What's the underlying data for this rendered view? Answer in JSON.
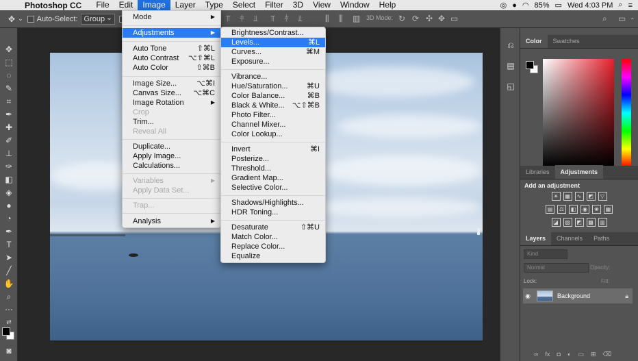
{
  "menubar": {
    "app_name": "Photoshop CC",
    "menus": [
      "File",
      "Edit",
      "Image",
      "Layer",
      "Type",
      "Select",
      "Filter",
      "3D",
      "View",
      "Window",
      "Help"
    ],
    "active_menu": "Image",
    "battery": "85%",
    "clock": "Wed 4:03 PM"
  },
  "options_bar": {
    "auto_select_label": "Auto-Select:",
    "auto_select_value": "Group",
    "show_label": "Sh",
    "mode_label": "3D Mode:"
  },
  "image_menu": {
    "items": [
      {
        "label": "Mode",
        "submenu": true
      },
      {
        "label": "Adjustments",
        "submenu": true,
        "highlighted": true
      },
      {
        "label": "Auto Tone",
        "shortcut": "⇧⌘L"
      },
      {
        "label": "Auto Contrast",
        "shortcut": "⌥⇧⌘L"
      },
      {
        "label": "Auto Color",
        "shortcut": "⇧⌘B"
      },
      {
        "label": "Image Size...",
        "shortcut": "⌥⌘I"
      },
      {
        "label": "Canvas Size...",
        "shortcut": "⌥⌘C"
      },
      {
        "label": "Image Rotation",
        "submenu": true
      },
      {
        "label": "Crop",
        "disabled": true
      },
      {
        "label": "Trim..."
      },
      {
        "label": "Reveal All",
        "disabled": true
      },
      {
        "label": "Duplicate..."
      },
      {
        "label": "Apply Image..."
      },
      {
        "label": "Calculations..."
      },
      {
        "label": "Variables",
        "submenu": true,
        "disabled": true
      },
      {
        "label": "Apply Data Set...",
        "disabled": true
      },
      {
        "label": "Trap...",
        "disabled": true
      },
      {
        "label": "Analysis",
        "submenu": true
      }
    ]
  },
  "adjustments_menu": {
    "items": [
      {
        "label": "Brightness/Contrast..."
      },
      {
        "label": "Levels...",
        "shortcut": "⌘L",
        "highlighted": true
      },
      {
        "label": "Curves...",
        "shortcut": "⌘M"
      },
      {
        "label": "Exposure..."
      },
      {
        "label": "Vibrance..."
      },
      {
        "label": "Hue/Saturation...",
        "shortcut": "⌘U"
      },
      {
        "label": "Color Balance...",
        "shortcut": "⌘B"
      },
      {
        "label": "Black & White...",
        "shortcut": "⌥⇧⌘B"
      },
      {
        "label": "Photo Filter..."
      },
      {
        "label": "Channel Mixer..."
      },
      {
        "label": "Color Lookup..."
      },
      {
        "label": "Invert",
        "shortcut": "⌘I"
      },
      {
        "label": "Posterize..."
      },
      {
        "label": "Threshold..."
      },
      {
        "label": "Gradient Map..."
      },
      {
        "label": "Selective Color..."
      },
      {
        "label": "Shadows/Highlights..."
      },
      {
        "label": "HDR Toning..."
      },
      {
        "label": "Desaturate",
        "shortcut": "⇧⌘U"
      },
      {
        "label": "Match Color..."
      },
      {
        "label": "Replace Color..."
      },
      {
        "label": "Equalize"
      }
    ]
  },
  "color_panel": {
    "tabs": [
      "Color",
      "Swatches"
    ],
    "active_tab": "Color",
    "foreground": "#000000",
    "background": "#ffffff"
  },
  "adjustments_panel": {
    "tabs": [
      "Libraries",
      "Adjustments"
    ],
    "active_tab": "Adjustments",
    "title": "Add an adjustment"
  },
  "layers_panel": {
    "tabs": [
      "Layers",
      "Channels",
      "Paths"
    ],
    "active_tab": "Layers",
    "filter_placeholder": "Kind",
    "blend_mode": "Normal",
    "opacity_label": "Opacity:",
    "lock_label": "Lock:",
    "fill_label": "Fill:",
    "layers": [
      {
        "name": "Background",
        "visible": true,
        "locked": true
      }
    ]
  },
  "colors": {
    "menu_highlight": "#2a7bf4",
    "panel_bg": "#535353",
    "app_bg": "#282828"
  }
}
